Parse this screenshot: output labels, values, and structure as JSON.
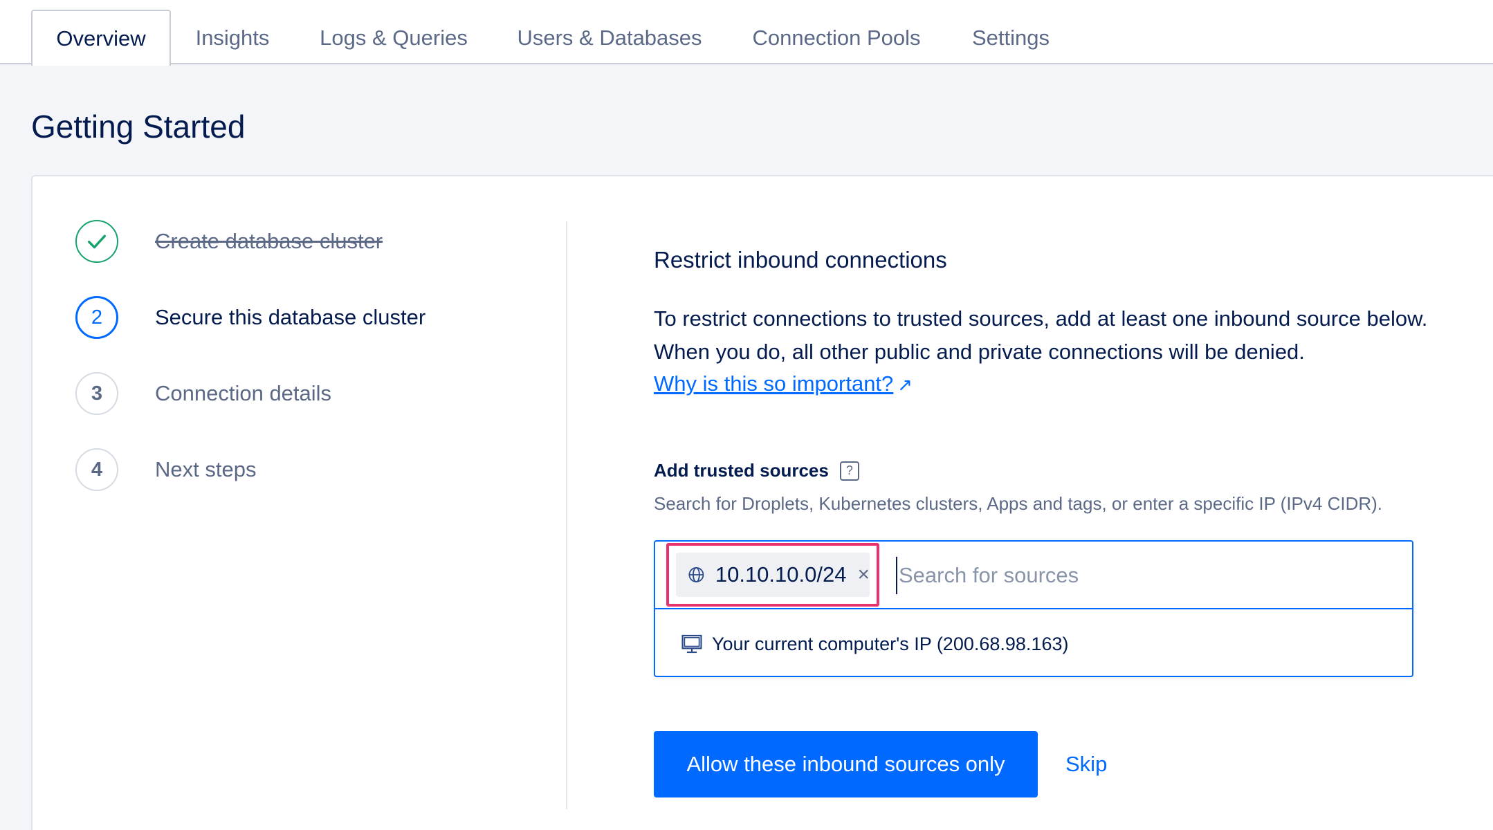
{
  "tabs": [
    {
      "label": "Overview",
      "active": true
    },
    {
      "label": "Insights"
    },
    {
      "label": "Logs & Queries"
    },
    {
      "label": "Users & Databases"
    },
    {
      "label": "Connection Pools"
    },
    {
      "label": "Settings"
    }
  ],
  "page_title": "Getting Started",
  "steps": [
    {
      "marker": "",
      "label": "Create database cluster",
      "state": "done"
    },
    {
      "marker": "2",
      "label": "Secure this database cluster",
      "state": "current"
    },
    {
      "marker": "3",
      "label": "Connection details",
      "state": "pending"
    },
    {
      "marker": "4",
      "label": "Next steps",
      "state": "pending"
    }
  ],
  "section": {
    "title": "Restrict inbound connections",
    "desc_line1": "To restrict connections to trusted sources, add at least one inbound source below.",
    "desc_line2": "When you do, all other public and private connections will be denied.",
    "link_text": "Why is this so important?",
    "link_arrow": "↗"
  },
  "trusted_sources": {
    "label": "Add trusted sources",
    "help_symbol": "?",
    "hint": "Search for Droplets, Kubernetes clusters, Apps and tags, or enter a specific IP (IPv4 CIDR).",
    "chip": {
      "icon": "globe-icon",
      "value": "10.10.10.0/24",
      "close": "×"
    },
    "search_placeholder": "Search for sources",
    "suggestion": {
      "icon": "monitor-icon",
      "text": "Your current computer's IP (200.68.98.163)"
    }
  },
  "actions": {
    "primary_label": "Allow these inbound sources only",
    "skip_label": "Skip"
  },
  "colors": {
    "accent": "#0069ff",
    "success": "#15a36b",
    "highlight": "#e8336d",
    "text": "#031b4e",
    "muted": "#5b6987"
  }
}
